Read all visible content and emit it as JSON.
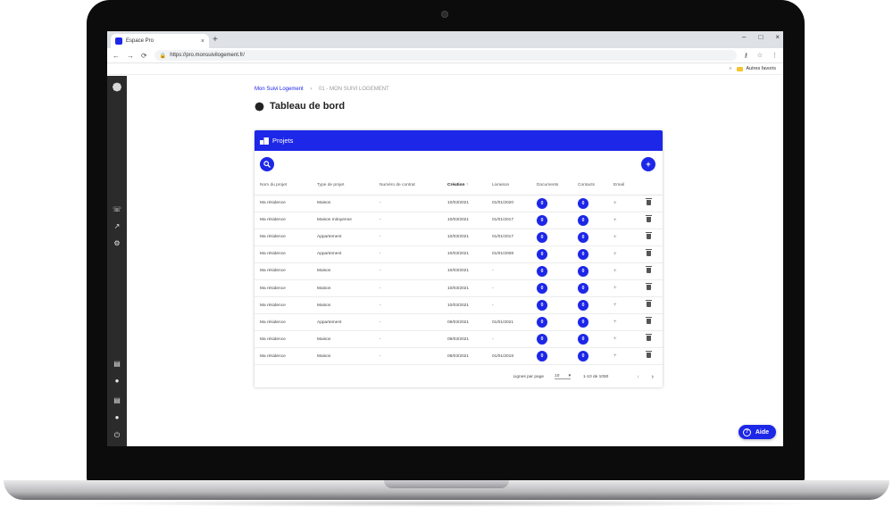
{
  "browser": {
    "tab_title": "Espace Pro",
    "tab_close": "×",
    "new_tab": "+",
    "win_minimize": "–",
    "win_maximize": "□",
    "win_close": "×",
    "url": "https://pro.monsuivilogement.fr/",
    "bookmark_folder": "Autres favoris"
  },
  "breadcrumb": {
    "root": "Mon Suivi Logement",
    "current": "01 - MON SUIVI LOGEMENT"
  },
  "page": {
    "title": "Tableau de bord"
  },
  "card": {
    "title": "Projets",
    "columns": [
      "Nom du projet",
      "Type de projet",
      "Numéro de contrat",
      "Création",
      "Livraison",
      "Documents",
      "Contacts",
      "Email",
      ""
    ],
    "sort_arrow": "↑",
    "rows": [
      {
        "name": "Ma résidence",
        "type": "Maison",
        "contract": "-",
        "created": "10/03/2021",
        "delivery": "01/01/2020",
        "docs": "0",
        "contacts": "0",
        "email": "+"
      },
      {
        "name": "Ma résidence",
        "type": "Maison mitoyenne",
        "contract": "-",
        "created": "10/03/2021",
        "delivery": "01/01/2017",
        "docs": "0",
        "contacts": "0",
        "email": "+"
      },
      {
        "name": "Ma résidence",
        "type": "Appartement",
        "contract": "-",
        "created": "10/03/2021",
        "delivery": "01/01/2017",
        "docs": "0",
        "contacts": "0",
        "email": "+"
      },
      {
        "name": "Ma résidence",
        "type": "Appartement",
        "contract": "-",
        "created": "10/03/2021",
        "delivery": "01/01/2008",
        "docs": "0",
        "contacts": "0",
        "email": "+"
      },
      {
        "name": "Ma résidence",
        "type": "Maison",
        "contract": "-",
        "created": "10/03/2021",
        "delivery": "-",
        "docs": "0",
        "contacts": "0",
        "email": "+"
      },
      {
        "name": "Ma résidence",
        "type": "Maison",
        "contract": "-",
        "created": "10/03/2021",
        "delivery": "-",
        "docs": "0",
        "contacts": "0",
        "email": "+"
      },
      {
        "name": "Ma résidence",
        "type": "Maison",
        "contract": "-",
        "created": "10/03/2021",
        "delivery": "-",
        "docs": "0",
        "contacts": "0",
        "email": "+"
      },
      {
        "name": "Ma résidence",
        "type": "Appartement",
        "contract": "-",
        "created": "09/03/2021",
        "delivery": "01/01/2021",
        "docs": "0",
        "contacts": "0",
        "email": "+"
      },
      {
        "name": "Ma résidence",
        "type": "Maison",
        "contract": "-",
        "created": "09/03/2021",
        "delivery": "-",
        "docs": "0",
        "contacts": "0",
        "email": "+"
      },
      {
        "name": "Ma résidence",
        "type": "Maison",
        "contract": "-",
        "created": "08/03/2021",
        "delivery": "01/01/2018",
        "docs": "0",
        "contacts": "0",
        "email": "+"
      }
    ],
    "pagination": {
      "rows_per_page_label": "Lignes par page",
      "rows_per_page_value": "10",
      "range": "1-10 de 1050",
      "prev": "‹",
      "next": "›"
    }
  },
  "help_button": {
    "label": "Aide",
    "icon": "?"
  },
  "colors": {
    "accent": "#1d27e8",
    "sidebar": "#2b2b2b"
  }
}
